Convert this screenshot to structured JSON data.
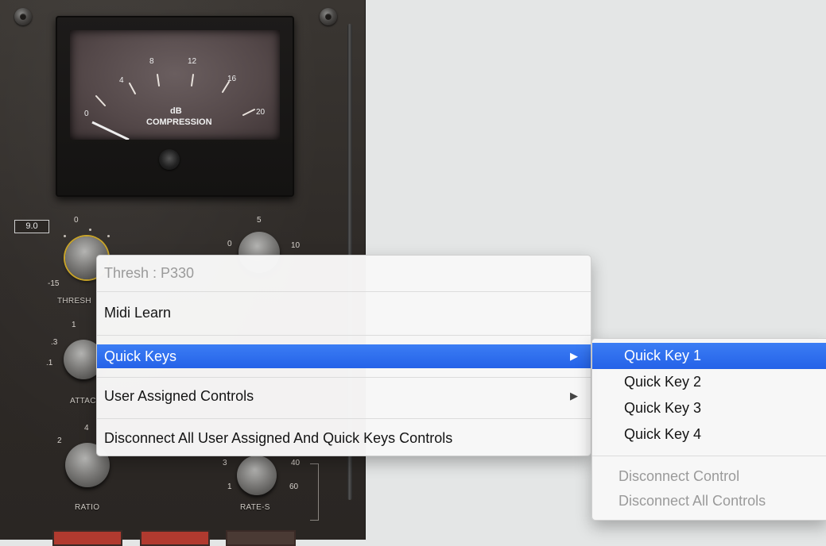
{
  "plugin": {
    "value_display": "9.0",
    "meter": {
      "scale": [
        "0",
        "4",
        "8",
        "12",
        "16",
        "20"
      ],
      "unit": "dB",
      "label": "COMPRESSION"
    },
    "threshold": {
      "label": "THRESH",
      "scale_min": "-15",
      "scale_top": "0"
    },
    "ratio_knob_top": {
      "scale_min": "0",
      "scale_top": "5",
      "scale_max": "10"
    },
    "attack": {
      "label": "ATTAC",
      "scale": [
        ".1",
        ".3",
        "1"
      ]
    },
    "ratio": {
      "label": "RATIO",
      "scale": [
        "2",
        "4"
      ]
    },
    "rate": {
      "label": "RATE-S",
      "scale": [
        "3",
        "1",
        "40",
        "60"
      ]
    }
  },
  "context_menu": {
    "title": "Thresh : P330",
    "items": [
      {
        "label": "Midi Learn"
      },
      {
        "label": "Quick Keys",
        "submenu": true,
        "highlighted": true
      },
      {
        "label": "User Assigned Controls",
        "submenu": true
      },
      {
        "label": "Disconnect All User Assigned And Quick Keys Controls"
      }
    ],
    "arrow": "▶"
  },
  "submenu": {
    "items": [
      "Quick Key 1",
      "Quick Key 2",
      "Quick Key 3",
      "Quick Key 4"
    ],
    "disabled": [
      "Disconnect Control",
      "Disconnect All Controls"
    ]
  },
  "colors": {
    "highlight": "#2f6ff0",
    "plugin_bg": "#2e2a27",
    "meter_face": "#544849"
  }
}
